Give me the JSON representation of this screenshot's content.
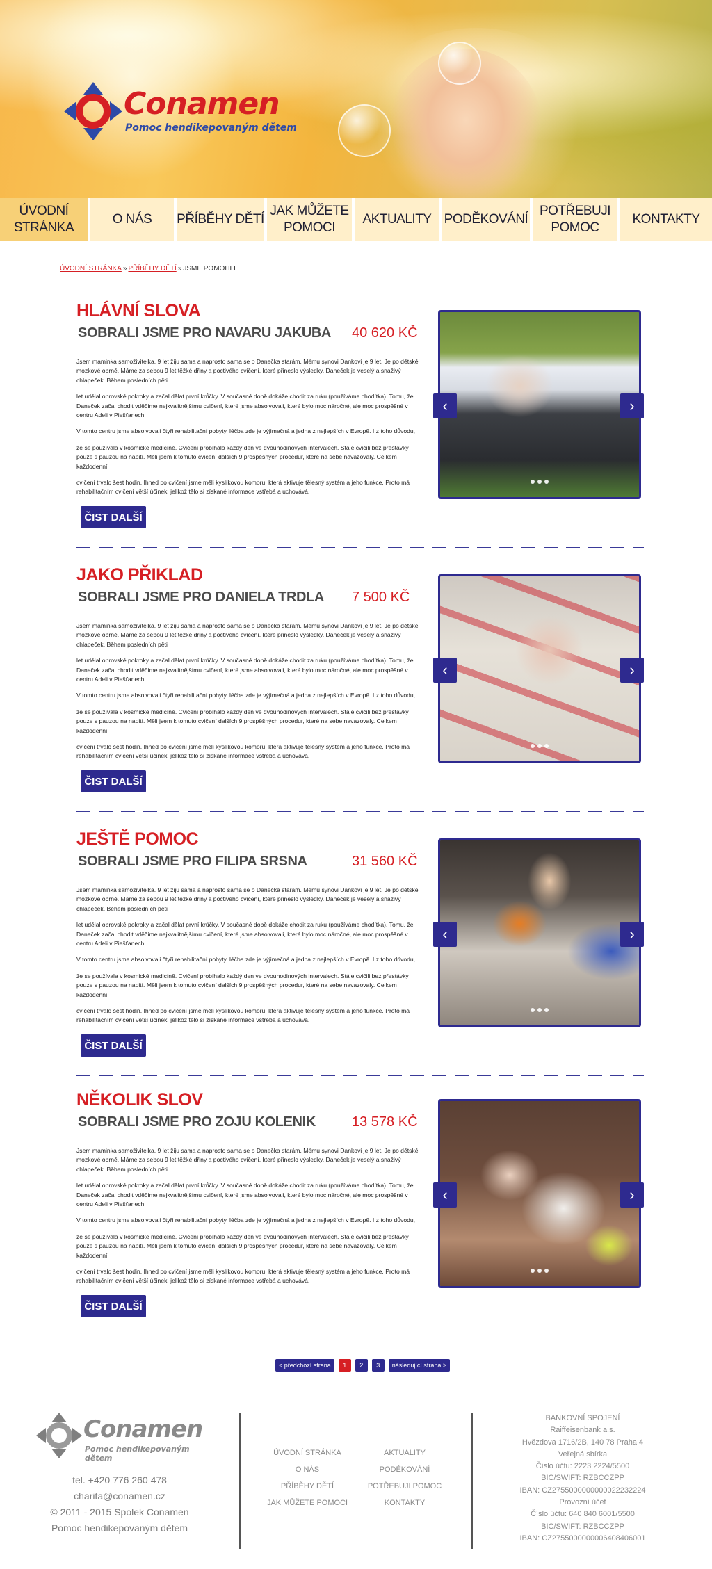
{
  "brand": {
    "name": "Conamen",
    "tagline": "Pomoc hendikepovaným dětem"
  },
  "nav": [
    {
      "label": "ÚVODNÍ STRÁNKA",
      "active": true
    },
    {
      "label": "O NÁS"
    },
    {
      "label": "PŘÍBĚHY DĚTÍ"
    },
    {
      "label": "JAK MŮŽETE POMOCI"
    },
    {
      "label": "AKTUALITY"
    },
    {
      "label": "PODĚKOVÁNÍ"
    },
    {
      "label": "POTŘEBUJI POMOC"
    },
    {
      "label": "KONTAKTY"
    }
  ],
  "breadcrumb": {
    "home": "ÚVODNÍ STRÁNKA",
    "section": "PŘÍBĚHY DĚTÍ",
    "current": "JSME POMOHLI",
    "separator": "»"
  },
  "body_text": [
    "Jsem maminka samoživitelka. 9 let žiju sama a naprosto sama se o Danečka starám. Mému synovi Dankovi je 9 let. Je po dětské mozkové obrně. Máme za sebou 9 let těžké dřiny a poctivého cvičení, které přineslo výsledky. Daneček je veselý a snaživý chlapeček. Během posledních pěti",
    "let udělal obrovské pokroky a začal dělat první krůčky. V současné době dokáže chodit za ruku (používáme chodítka). Tomu, že Daneček začal chodit vděčíme nejkvalitnějšímu cvičení, které jsme absolvovali, které bylo moc náročné, ale moc prospěšné v centru Adeli v Piešťanech.",
    "V tomto centru jsme absolvovali čtyři rehabilitační pobyty, léčba zde je výjimečná a jedna z nejlepších v Evropě. I z toho důvodu,",
    "že se používala v kosmické medicíně. Cvičení probíhalo každý den ve dvouhodinových intervalech. Stále cvičili bez přestávky pouze s pauzou na napití. Měli jsem k tomuto cvičení dalších 9 prospěšných procedur, které na sebe navazovaly. Celkem každodenní",
    "cvičení trvalo šest hodin. Ihned po cvičení jsme měli kyslíkovou komoru, která aktivuje tělesný systém a jeho funkce. Proto má rehabilitačním cvičení větší účinek, jelikož tělo si získané informace vstřebá a uchovává."
  ],
  "read_more_label": "ČIST DALŠÍ",
  "stories": [
    {
      "heading": "HLÁVNÍ SLOVA",
      "title": "SOBRALI JSME PRO NAVARU JAKUBA",
      "amount": "40 620 KČ"
    },
    {
      "heading": "JAKO PŘIKLAD",
      "title": "SOBRALI JSME PRO DANIELA TRDLA",
      "amount": "7 500 KČ"
    },
    {
      "heading": "JEŠTĚ POMOC",
      "title": "SOBRALI JSME PRO FILIPA SRSNA",
      "amount": "31 560 KČ"
    },
    {
      "heading": "NĚKOLIK SLOV",
      "title": "SOBRALI JSME PRO ZOJU KOLENIK",
      "amount": "13 578 KČ"
    }
  ],
  "slider": {
    "prev_icon": "‹",
    "next_icon": "›"
  },
  "pagination": {
    "prev": "< předchozí strana",
    "pages": [
      "1",
      "2",
      "3"
    ],
    "current": "1",
    "next": "následující strana >"
  },
  "footer": {
    "phone": "tel. +420 776 260 478",
    "email": "charita@conamen.cz",
    "copyright": "© 2011 - 2015 Spolek Conamen",
    "tagline": "Pomoc hendikepovaným dětem",
    "links_left": [
      "ÚVODNÍ STRÁNKA",
      "O NÁS",
      "PŘÍBĚHY DĚTÍ",
      "JAK MŮŽETE POMOCI"
    ],
    "links_right": [
      "AKTUALITY",
      "PODĚKOVÁNÍ",
      "POTŘEBUJI POMOC",
      "KONTAKTY"
    ],
    "bank": [
      "BANKOVNÍ SPOJENÍ",
      "Raiffeisenbank a.s.",
      "Hvězdova 1716/2B, 140 78 Praha 4",
      "Veřejná sbírka",
      "Číslo účtu: 2223 2224/5500",
      "BIC/SWIFT: RZBCCZPP",
      "IBAN: CZ2755000000000022232224",
      "Provozní účet",
      "Číslo účtu: 640 840 6001/5500",
      "BIC/SWIFT: RZBCCZPP",
      "IBAN: CZ2755000000006408406001"
    ]
  },
  "colors": {
    "accent_red": "#d61f24",
    "accent_blue": "#2e2a8f",
    "logo_blue": "#2e4aa7"
  }
}
